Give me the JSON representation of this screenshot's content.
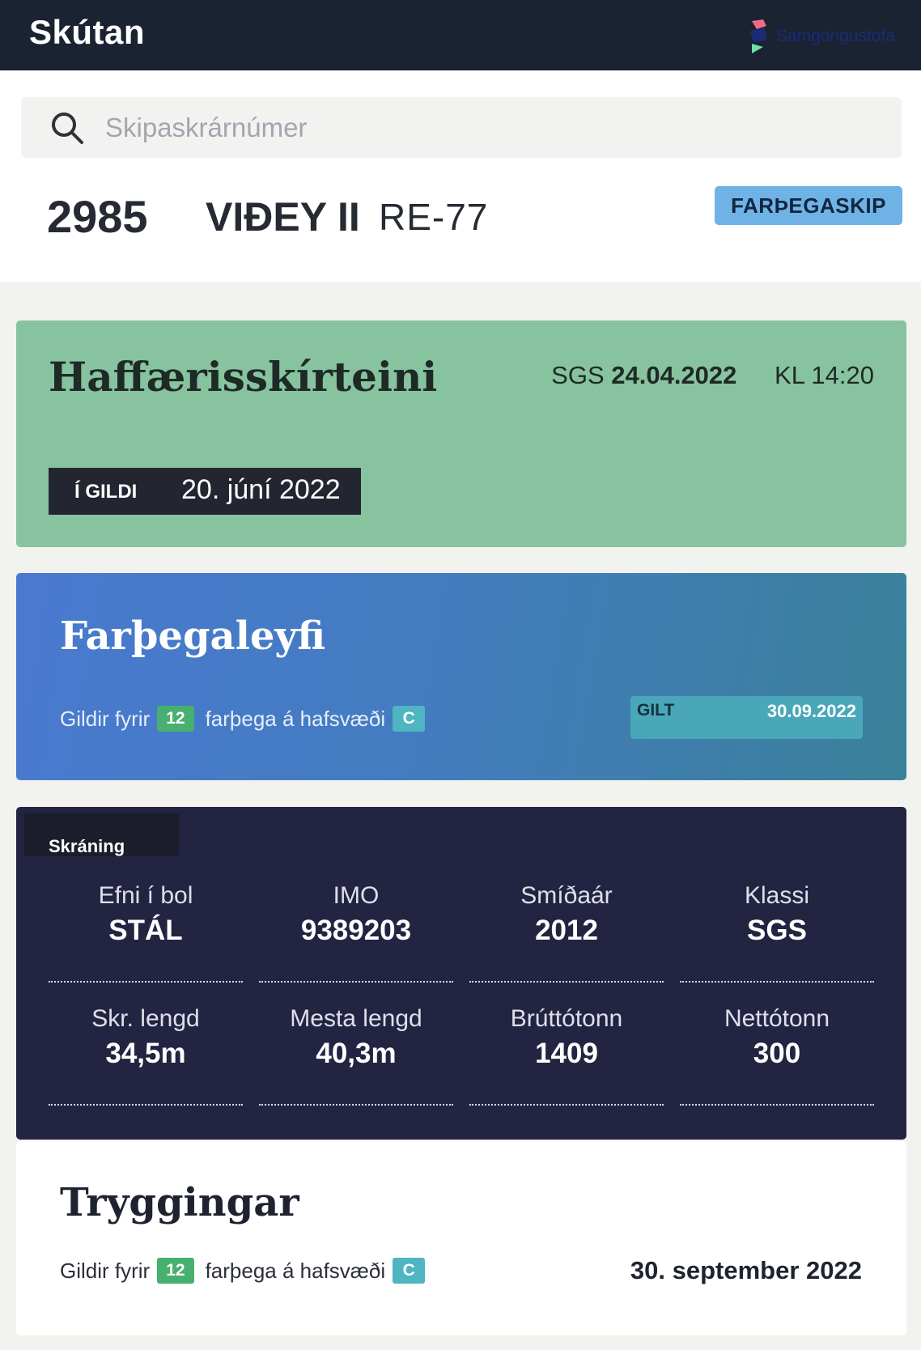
{
  "app": {
    "title": "Skútan",
    "brand_name": "Samgöngustofa"
  },
  "search": {
    "placeholder": "Skipaskrárnúmer",
    "value": ""
  },
  "ship": {
    "number": "2985",
    "name": "VIÐEY II",
    "registration": "RE-77",
    "type": "FARÞEGASKIP"
  },
  "certificate": {
    "title": "Haffærisskírteini",
    "issuer": "SGS",
    "date": "24.04.2022",
    "time": "KL 14:20",
    "valid_label": "Í GILDI",
    "valid_until": "20. júní 2022"
  },
  "passenger_permit": {
    "title": "Farþegaleyfi",
    "valid_for_prefix": "Gildir fyrir",
    "passenger_count": "12",
    "zone_text": "farþega á hafsvæði",
    "zone": "C",
    "valid_label": "GILT",
    "valid_until": "30.09.2022"
  },
  "registration": {
    "tab_label": "Skráning",
    "fields": [
      {
        "label": "Efni í bol",
        "value": "STÁL"
      },
      {
        "label": "IMO",
        "value": "9389203"
      },
      {
        "label": "Smíðaár",
        "value": "2012"
      },
      {
        "label": "Klassi",
        "value": "SGS"
      },
      {
        "label": "Skr. lengd",
        "value": "34,5m"
      },
      {
        "label": "Mesta lengd",
        "value": "40,3m"
      },
      {
        "label": "Brúttótonn",
        "value": "1409"
      },
      {
        "label": "Nettótonn",
        "value": "300"
      }
    ]
  },
  "insurance": {
    "title": "Tryggingar",
    "valid_for_prefix": "Gildir fyrir",
    "passenger_count": "12",
    "zone_text": "farþega á hafsvæði",
    "zone": "C",
    "valid_until": "30. september 2022"
  },
  "colors": {
    "topbar": "#1b2232",
    "certificate_bg": "#87c39f",
    "permit_gradient_start": "#4a79d0",
    "permit_gradient_end": "#3a8099",
    "registration_bg": "#232442",
    "type_badge": "#6fb3e6",
    "count_pill": "#48b06f",
    "zone_pill": "#4fb5c0"
  },
  "icons": {
    "search": "search-icon",
    "brand": "samgongustofa-logo-icon"
  }
}
